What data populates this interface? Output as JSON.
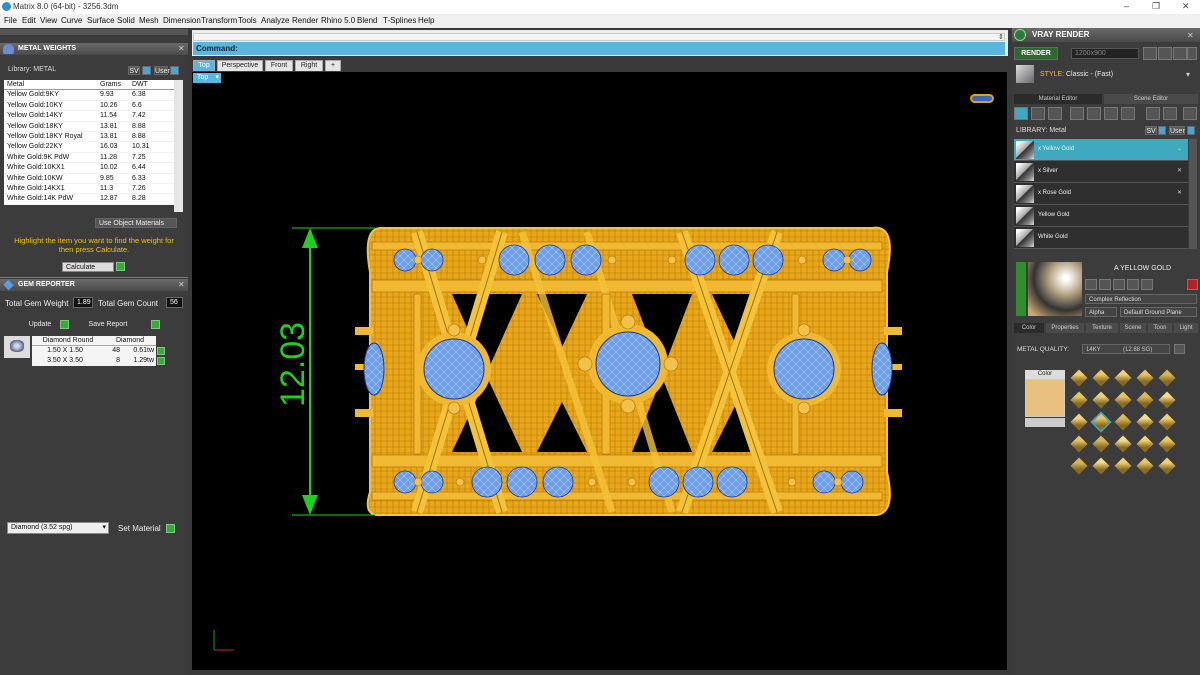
{
  "window": {
    "title": "Matrix 8.0 (64-bit) - 3256.3dm"
  },
  "menu": [
    "File",
    "Edit",
    "View",
    "Curve",
    "Surface",
    "Solid",
    "Mesh",
    "Dimension",
    "Transform",
    "Tools",
    "Analyze",
    "Render",
    "Rhino 5.0",
    "Blend",
    "T-Splines",
    "Help"
  ],
  "metal_weights": {
    "title": "METAL WEIGHTS",
    "library_label": "Library: METAL",
    "library_btn1": "SV",
    "library_btn2": "User",
    "columns": [
      "Metal",
      "Grams",
      "DWT"
    ],
    "rows": [
      [
        "Yellow Gold:9KY",
        "9.93",
        "6.38"
      ],
      [
        "Yellow Gold:10KY",
        "10.26",
        "6.6"
      ],
      [
        "Yellow Gold:14KY",
        "11.54",
        "7.42"
      ],
      [
        "Yellow Gold:18KY",
        "13.81",
        "8.88"
      ],
      [
        "Yellow Gold:18KY Royal",
        "13.81",
        "8.88"
      ],
      [
        "Yellow Gold:22KY",
        "16.03",
        "10.31"
      ],
      [
        "White Gold:9K PdW",
        "11.28",
        "7.25"
      ],
      [
        "White Gold:10KX1",
        "10.02",
        "6.44"
      ],
      [
        "White Gold:10KW",
        "9.85",
        "6.33"
      ],
      [
        "White Gold:14KX1",
        "11.3",
        "7.26"
      ],
      [
        "White Gold:14K PdW",
        "12.87",
        "8.28"
      ]
    ],
    "use_object_materials": "Use Object Materials",
    "hint": "Highlight the item you want to find the weight for then press Calculate.",
    "calculate": "Calculate"
  },
  "gem_reporter": {
    "title": "GEM REPORTER",
    "total_weight_label": "Total Gem Weight",
    "total_weight": "1.89",
    "total_count_label": "Total Gem Count",
    "total_count": "56",
    "update": "Update",
    "save_report": "Save Report",
    "columns": [
      "Diamond Round",
      "Diamond"
    ],
    "rows": [
      [
        "1.50 X 1.50",
        "48",
        "0.61tw"
      ],
      [
        "3.50 X 3.50",
        "8",
        "1.29tw"
      ]
    ],
    "material_select": "Diamond    (3.52 spg)",
    "set_material": "Set Material"
  },
  "command": {
    "label": "Command:",
    "value": ""
  },
  "view_tabs": [
    "Top",
    "Perspective",
    "Front",
    "Right",
    "+"
  ],
  "viewport": {
    "active_view": "Top",
    "dimension": "12.03",
    "background": "#000000",
    "metal_color": "#e9a81c",
    "gem_color": "#6f9ee8",
    "dim_color": "#1fd01f"
  },
  "vray": {
    "title": "VRAY RENDER",
    "render_label": "RENDER",
    "resolution": "1200x900",
    "style_label": "STYLE:",
    "style_value": "Classic - (Fast)",
    "tabs": [
      "Material Editor",
      "Scene Editor"
    ],
    "library_label": "LIBRARY: Metal",
    "library_btn1": "SV",
    "library_btn2": "User",
    "materials": [
      "x Yellow Gold",
      "x Silver",
      "x Rose Gold",
      "Yellow Gold",
      "White Gold"
    ],
    "selected_material": "A YELLOW GOLD",
    "reflection": "Complex Reflection",
    "alpha_label": "Alpha",
    "ground": "Default Ground Plane",
    "sub_tabs": [
      "Color",
      "Properties",
      "Texture",
      "Scene",
      "Toon",
      "Light"
    ],
    "metal_quality_label": "METAL QUALITY:",
    "metal_quality_value": "14KY",
    "metal_quality_extra": "(12.88 SG)",
    "color_label": "Color",
    "color_swatch": "#e8c080"
  }
}
